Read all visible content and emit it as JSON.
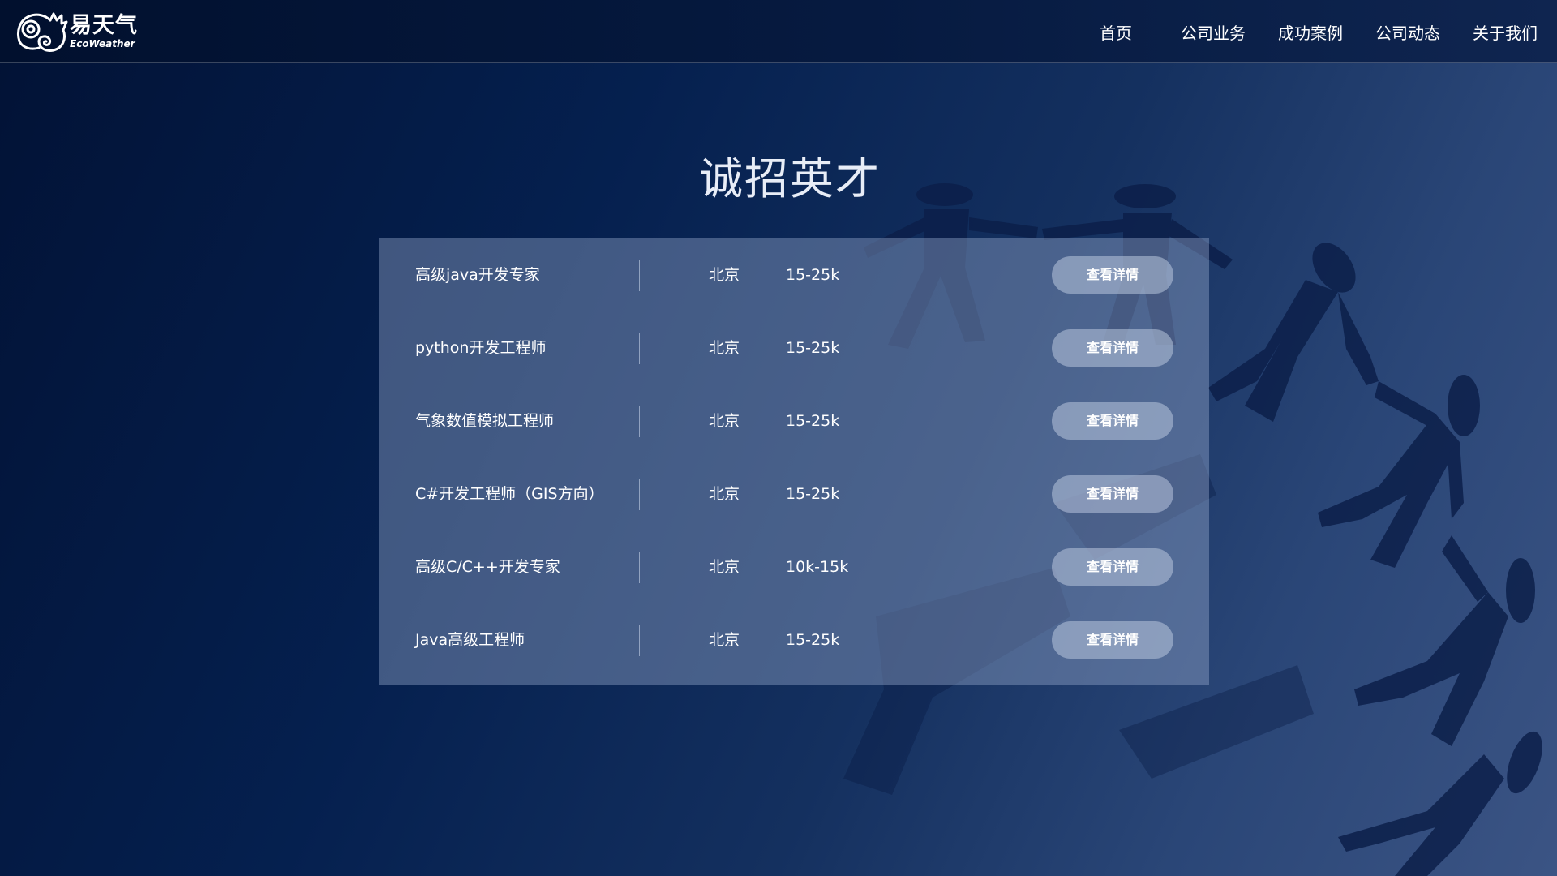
{
  "logo": {
    "name_cn": "易天气",
    "name_en": "EcoWeather"
  },
  "nav": {
    "items": [
      {
        "label": "首页"
      },
      {
        "label": "公司业务"
      },
      {
        "label": "成功案例"
      },
      {
        "label": "公司动态"
      },
      {
        "label": "关于我们"
      }
    ]
  },
  "page": {
    "title": "诚招英才"
  },
  "jobs": [
    {
      "name": "高级java开发专家",
      "city": "北京",
      "salary": "15-25k",
      "button": "查看详情"
    },
    {
      "name": "python开发工程师",
      "city": "北京",
      "salary": "15-25k",
      "button": "查看详情"
    },
    {
      "name": "气象数值模拟工程师",
      "city": "北京",
      "salary": "15-25k",
      "button": "查看详情"
    },
    {
      "name": "C#开发工程师（GIS方向）",
      "city": "北京",
      "salary": "15-25k",
      "button": "查看详情"
    },
    {
      "name": "高级C/C++开发专家",
      "city": "北京",
      "salary": "10k-15k",
      "button": "查看详情"
    },
    {
      "name": "Java高级工程师",
      "city": "北京",
      "salary": "15-25k",
      "button": "查看详情"
    }
  ],
  "colors": {
    "header_bg": "#01102e",
    "page_bg": "#05204f",
    "button_bg": "#9aaac8",
    "figure_silhouette": "#0c1f4a"
  }
}
